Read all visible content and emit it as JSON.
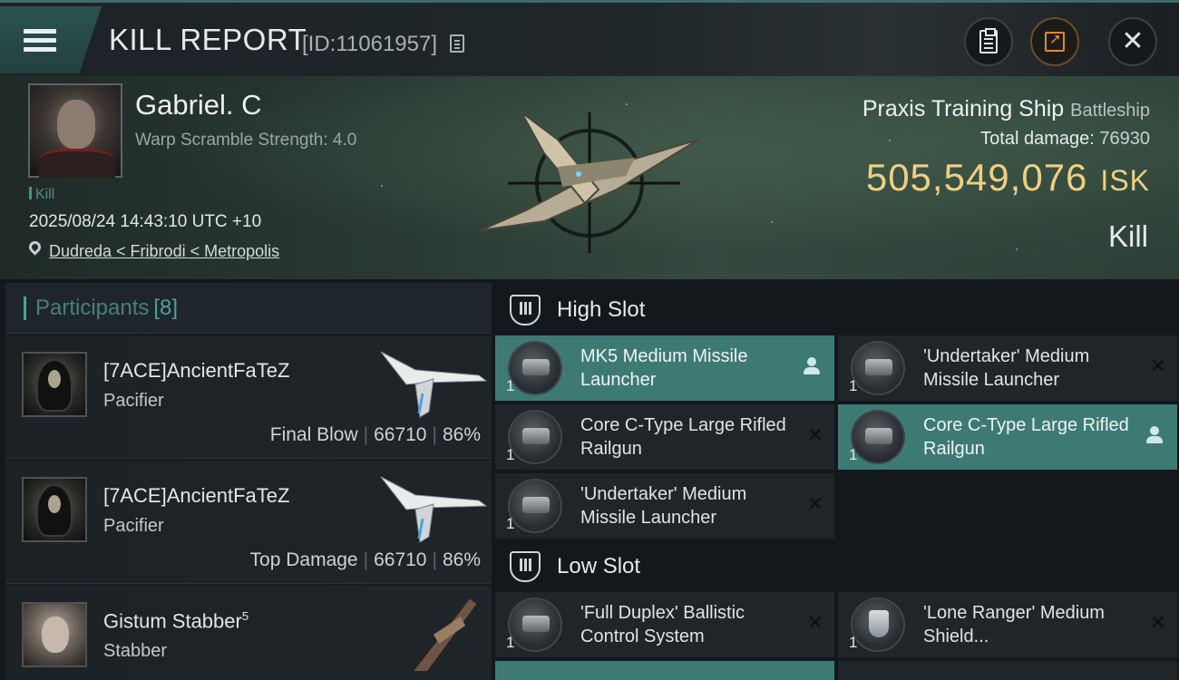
{
  "header": {
    "title": "KILL REPORT",
    "report_id": "[ID:11061957]"
  },
  "victim": {
    "name": "Gabriel. C",
    "warp_scramble": "Warp Scramble Strength: 4.0",
    "tag": "Kill",
    "time": "2025/08/24 14:43:10 UTC +10",
    "location": "Dudreda < Fribrodi < Metropolis",
    "ship_name": "Praxis Training Ship",
    "ship_class": "Battleship",
    "damage_label": "Total damage:",
    "damage_value": "76930",
    "isk_value": "505,549,076",
    "isk_unit": "ISK",
    "result": "Kill"
  },
  "participants": {
    "label": "Participants",
    "count": "[8]",
    "rows": [
      {
        "name": "[7ACE]AncientFaTeZ",
        "ship": "Pacifier",
        "role": "Final Blow",
        "damage": "66710",
        "percent": "86%"
      },
      {
        "name": "[7ACE]AncientFaTeZ",
        "ship": "Pacifier",
        "role": "Top Damage",
        "damage": "66710",
        "percent": "86%"
      },
      {
        "name": "Gistum Stabber",
        "sup": "5",
        "ship": "Stabber"
      }
    ]
  },
  "fitting": {
    "high_slot_label": "High Slot",
    "low_slot_label": "Low Slot",
    "high": [
      {
        "name": "MK5 Medium Missile Launcher",
        "qty": "1"
      },
      {
        "name": "'Undertaker' Medium Missile Launcher",
        "qty": "1"
      },
      {
        "name": "Core C-Type Large Rifled Railgun",
        "qty": "1"
      },
      {
        "name": "Core C-Type Large Rifled Railgun",
        "qty": "1"
      },
      {
        "name": "'Undertaker' Medium Missile Launcher",
        "qty": "1"
      }
    ],
    "low": [
      {
        "name": "'Full Duplex' Ballistic Control System",
        "qty": "1"
      },
      {
        "name": "'Lone Ranger' Medium Shield...",
        "qty": "1"
      }
    ]
  },
  "colors": {
    "accent_teal": "#4fa09a",
    "isk_gold": "#f0cf80",
    "active_module": "#3e7a74",
    "share_orange": "#e08a2b"
  }
}
